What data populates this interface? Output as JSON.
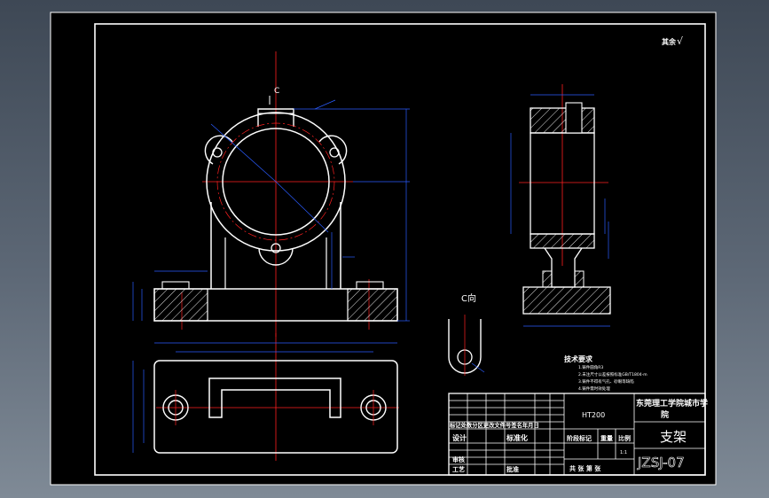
{
  "drawing": {
    "roughness_note": "其余",
    "roughness_symbol": "√",
    "views": {
      "section_marker": "C",
      "aux_view_title": "C向"
    },
    "technical_requirements": {
      "title": "技术要求",
      "items": [
        "1.铸件圆角R3",
        "2.未注尺寸公差按照标准GB/T1804-m",
        "3.铸件不得有气孔、砂眼等缺陷",
        "4.铸件需时效处理"
      ]
    },
    "title_block": {
      "material": "HT200",
      "school": "东莞理工学院城市学院",
      "part_name": "支架",
      "drawing_number": "JZSJ-07",
      "header_row": "标记处数分区更改文件号签名年月日",
      "design_label": "设计",
      "standardize_label": "标准化",
      "review_label": "审核",
      "process_label": "工艺",
      "approve_label": "批准",
      "stage_mark_label": "阶段标记",
      "weight_label": "重量",
      "scale_label": "比例",
      "scale_value": "1:1",
      "sheet_info": "共  张 第  张"
    },
    "colors": {
      "outline": "#ffffff",
      "centerline": "#ff2020",
      "dimension": "#2a5cff",
      "hatch": "#ffffff",
      "background": "#000000"
    }
  }
}
